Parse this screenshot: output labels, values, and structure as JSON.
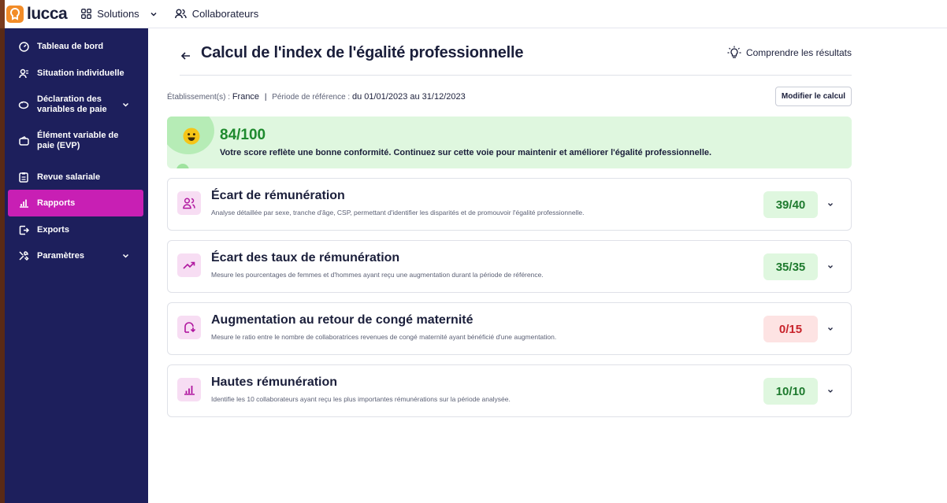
{
  "topbar": {
    "logo_text": "lucca",
    "nav": [
      {
        "label": "Solutions",
        "icon": "grid-icon"
      },
      {
        "label": "Collaborateurs",
        "icon": "users-icon"
      }
    ]
  },
  "sidebar": {
    "items": [
      {
        "label": "Tableau de bord",
        "icon": "dashboard-icon",
        "active": false
      },
      {
        "label": "Situation individuelle",
        "icon": "person-icon",
        "active": false
      },
      {
        "label": "Déclaration des variables de paie",
        "icon": "piggy-bank-icon",
        "active": false,
        "expandable": true
      },
      {
        "label": "Élément variable de paie (EVP)",
        "icon": "wallet-icon",
        "active": false
      },
      {
        "label": "Revue salariale",
        "icon": "clipboard-icon",
        "active": false
      },
      {
        "label": "Rapports",
        "icon": "bar-chart-icon",
        "active": true
      },
      {
        "label": "Exports",
        "icon": "export-icon",
        "active": false
      },
      {
        "label": "Paramètres",
        "icon": "tools-icon",
        "active": false,
        "expandable": true
      }
    ]
  },
  "header": {
    "title": "Calcul de l'index de l'égalité professionnelle",
    "understand_label": "Comprendre les résultats"
  },
  "context": {
    "establishment_label": "Établissement(s) :",
    "establishment_value": "France",
    "separator": "|",
    "period_label": "Période de référence :",
    "period_value": "du 01/01/2023 au 31/12/2023",
    "modify_button": "Modifier le calcul"
  },
  "score": {
    "value": "84/100",
    "message": "Votre score reflète une bonne conformité. Continuez sur cette voie pour maintenir et améliorer l'égalité professionnelle."
  },
  "cards": [
    {
      "title": "Écart de rémunération",
      "description": "Analyse détaillée par sexe, tranche d'âge, CSP, permettant d'identifier les disparités et de promouvoir l'égalité professionnelle.",
      "score": "39/40",
      "status": "good",
      "icon": "users-compare-icon"
    },
    {
      "title": "Écart des taux de rémunération",
      "description": "Mesure les pourcentages de femmes et d'hommes ayant reçu une augmentation durant la période de référence.",
      "score": "35/35",
      "status": "good",
      "icon": "trending-up-icon"
    },
    {
      "title": "Augmentation au retour de congé maternité",
      "description": "Mesure le ratio entre le nombre de collaboratrices revenues de congé maternité ayant bénéficié d'une augmentation.",
      "score": "0/15",
      "status": "bad",
      "icon": "return-icon"
    },
    {
      "title": "Hautes rémunération",
      "description": "Identifie les 10 collaborateurs ayant reçu les plus importantes rémunérations sur la période analysée.",
      "score": "10/10",
      "status": "good",
      "icon": "bar-chart-icon"
    }
  ],
  "colors": {
    "sidebar_bg": "#1d1f5c",
    "active_item": "#c81fb4",
    "score_good": "#1e7a2e",
    "score_bad": "#c8232b",
    "banner_bg": "#dff7df"
  }
}
